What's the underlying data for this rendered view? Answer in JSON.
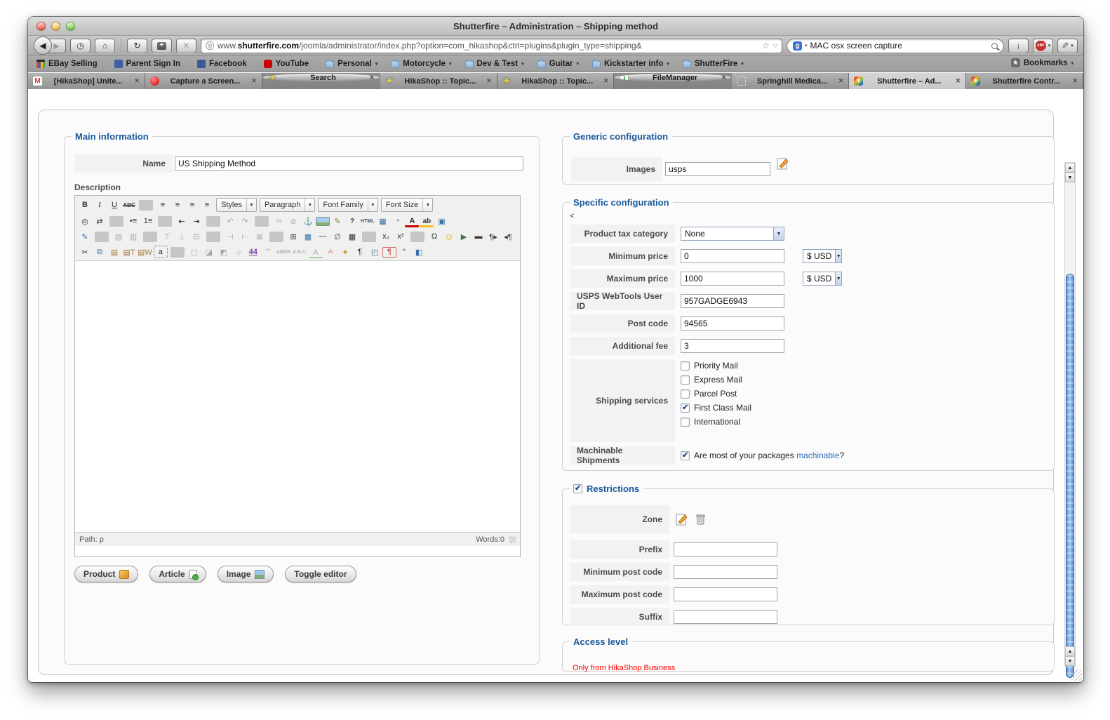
{
  "window": {
    "title": "Shutterfire – Administration – Shipping method"
  },
  "browser": {
    "nav": {
      "back": "◀",
      "forward": "▶",
      "history": "◷",
      "home": "⌂",
      "refresh": "↻",
      "save_plus": "+",
      "stop": "✕",
      "download": "↓",
      "star": "☆",
      "star_caret": "▽",
      "abp_label": "ABP",
      "quill": "✎"
    },
    "url": {
      "prefix": "www.",
      "domain": "shutterfire.com",
      "path": "/joomla/administrator/index.php?option=com_hikashop&ctrl=plugins&plugin_type=shipping&"
    },
    "search": {
      "engine_glyph": "g",
      "value": "MAC osx screen capture"
    },
    "bookmarks": [
      {
        "label": "EBay Selling",
        "icon": "ebay",
        "dropdown": false
      },
      {
        "label": "Parent Sign In",
        "icon": "p-badge",
        "dropdown": false
      },
      {
        "label": "Facebook",
        "icon": "facebook",
        "dropdown": false
      },
      {
        "label": "YouTube",
        "icon": "youtube",
        "dropdown": false
      },
      {
        "label": "Personal",
        "icon": "folder",
        "dropdown": true
      },
      {
        "label": "Motorcycle",
        "icon": "folder",
        "dropdown": true
      },
      {
        "label": "Dev & Test",
        "icon": "folder",
        "dropdown": true
      },
      {
        "label": "Guitar",
        "icon": "folder",
        "dropdown": true
      },
      {
        "label": "Kickstarter info",
        "icon": "folder",
        "dropdown": true
      },
      {
        "label": "ShutterFire",
        "icon": "folder",
        "dropdown": true
      }
    ],
    "bookmarks_menu_label": "Bookmarks",
    "tabs": [
      {
        "label": "[HikaShop] Unite...",
        "icon": "gmail",
        "active": false,
        "light": false
      },
      {
        "label": "Capture a Screen...",
        "icon": "balloon",
        "active": false,
        "light": false
      },
      {
        "label": "Search",
        "icon": "asterisk",
        "active": false,
        "light": true
      },
      {
        "label": "HikaShop :: Topic...",
        "icon": "asterisk",
        "active": false,
        "light": false
      },
      {
        "label": "HikaShop :: Topic...",
        "icon": "asterisk",
        "active": false,
        "light": false
      },
      {
        "label": "FileManager",
        "icon": "filemanager",
        "active": false,
        "light": true
      },
      {
        "label": "Springhill Medica...",
        "icon": "dashed",
        "active": false,
        "light": false
      },
      {
        "label": "Shutterfire – Ad...",
        "icon": "joomla",
        "active": true,
        "light": false
      },
      {
        "label": "Shutterfire Contr...",
        "icon": "joomla",
        "active": false,
        "light": false
      }
    ],
    "tab_close": "✕"
  },
  "page": {
    "main_information": {
      "legend": "Main information",
      "name_label": "Name",
      "name_value": "US Shipping Method",
      "description_label": "Description",
      "editor": {
        "row1_icons": [
          {
            "n": "bold-icon",
            "g": "B",
            "cls": "b"
          },
          {
            "n": "italic-icon",
            "g": "I",
            "cls": "i"
          },
          {
            "n": "underline-icon",
            "g": "U",
            "cls": "u"
          },
          {
            "n": "strikethrough-icon",
            "g": "ABC",
            "cls": "abc"
          },
          {
            "sep": true
          },
          {
            "n": "align-left-icon",
            "g": "≡"
          },
          {
            "n": "align-center-icon",
            "g": "≡"
          },
          {
            "n": "align-right-icon",
            "g": "≡"
          },
          {
            "n": "align-justify-icon",
            "g": "≡"
          }
        ],
        "selects": [
          {
            "n": "styles-select",
            "label": "Styles",
            "w": "sel-styles"
          },
          {
            "n": "paragraph-select",
            "label": "Paragraph",
            "w": "sel-para"
          },
          {
            "n": "font-family-select",
            "label": "Font Family",
            "w": "sel-font"
          },
          {
            "n": "font-size-select",
            "label": "Font Size",
            "w": "sel-size"
          }
        ],
        "row2_icons": [
          {
            "n": "find-icon",
            "g": "◎"
          },
          {
            "n": "find-replace-icon",
            "g": "⇄"
          },
          {
            "sep": true
          },
          {
            "n": "bullet-list-icon",
            "g": "•≡"
          },
          {
            "n": "numbered-list-icon",
            "g": "1≡"
          },
          {
            "sep": true
          },
          {
            "n": "outdent-icon",
            "g": "⇤"
          },
          {
            "n": "indent-icon",
            "g": "⇥"
          },
          {
            "sep": true
          },
          {
            "n": "undo-icon",
            "g": "↶",
            "dim": true
          },
          {
            "n": "redo-icon",
            "g": "↷",
            "dim": true
          },
          {
            "sep": true
          },
          {
            "n": "link-icon",
            "g": "∞",
            "dim": true
          },
          {
            "n": "unlink-icon",
            "g": "⊘",
            "dim": true
          },
          {
            "n": "anchor-icon",
            "g": "⚓",
            "cls": "c-navy"
          },
          {
            "n": "insert-image-icon",
            "g": "",
            "cls": "pic"
          },
          {
            "n": "cleanup-icon",
            "g": "✎",
            "cls": "c-olive"
          },
          {
            "n": "help-icon",
            "g": "?",
            "cls": "circ"
          },
          {
            "n": "html-source-icon",
            "g": "HTML",
            "cls": "txt"
          },
          {
            "n": "insert-date-icon",
            "g": "▦",
            "cls": "c-blue"
          },
          {
            "n": "insert-time-icon",
            "g": "◔",
            "cls": "c-blue"
          },
          {
            "n": "forecolor-icon",
            "g": "A",
            "cls": "fore"
          },
          {
            "n": "backcolor-icon",
            "g": "ab",
            "cls": "back"
          },
          {
            "n": "fullscreen-icon",
            "g": "▣",
            "cls": "c-blue"
          }
        ],
        "row3_icons": [
          {
            "n": "table-edit-icon",
            "g": "✎",
            "cls": "c-blue"
          },
          {
            "sep": true
          },
          {
            "n": "table-row-props-icon",
            "g": "▤",
            "dim": true
          },
          {
            "n": "table-cell-props-icon",
            "g": "▥",
            "dim": true
          },
          {
            "sep": true
          },
          {
            "n": "insert-row-before-icon",
            "g": "⊤",
            "dim": true
          },
          {
            "n": "insert-row-after-icon",
            "g": "⊥",
            "dim": true
          },
          {
            "n": "delete-row-icon",
            "g": "⊟",
            "dim": true
          },
          {
            "sep": true
          },
          {
            "n": "insert-col-before-icon",
            "g": "⊣",
            "dim": true
          },
          {
            "n": "insert-col-after-icon",
            "g": "⊢",
            "dim": true
          },
          {
            "n": "delete-col-icon",
            "g": "⊠",
            "dim": true
          },
          {
            "sep": true
          },
          {
            "n": "insert-table-icon",
            "g": "⊞"
          },
          {
            "n": "table-props-icon",
            "g": "▦",
            "cls": "c-blue"
          },
          {
            "n": "horizontal-rule-icon",
            "g": "—"
          },
          {
            "n": "remove-format-icon",
            "g": "∅"
          },
          {
            "n": "visual-aid-icon",
            "g": "▦"
          },
          {
            "sep": true
          },
          {
            "n": "subscript-icon",
            "g": "x₂"
          },
          {
            "n": "superscript-icon",
            "g": "x²"
          },
          {
            "sep": true
          },
          {
            "n": "special-char-icon",
            "g": "Ω"
          },
          {
            "n": "emoticon-icon",
            "g": "☺",
            "cls": "smiley"
          },
          {
            "n": "media-icon",
            "g": "▶",
            "cls": "media"
          },
          {
            "n": "advanced-hr-icon",
            "g": "▬"
          },
          {
            "n": "ltr-icon",
            "g": "¶▸"
          },
          {
            "n": "rtl-icon",
            "g": "◂¶"
          }
        ],
        "row4_icons": [
          {
            "n": "cut-icon",
            "g": "✂"
          },
          {
            "n": "copy-icon",
            "g": "⧉",
            "cls": "c-blue"
          },
          {
            "n": "paste-icon",
            "g": "▤",
            "cls": "c-brown"
          },
          {
            "n": "paste-text-icon",
            "g": "▤T",
            "cls": "c-brown"
          },
          {
            "n": "paste-word-icon",
            "g": "▤W",
            "cls": "c-brown"
          },
          {
            "n": "select-all-icon",
            "g": "a",
            "cls": "dashed"
          },
          {
            "sep": true
          },
          {
            "n": "toggle-absolute-icon",
            "g": "▢",
            "dim": true
          },
          {
            "n": "layer-forward-icon",
            "g": "◪",
            "dim": true
          },
          {
            "n": "layer-backward-icon",
            "g": "◩",
            "dim": true
          },
          {
            "n": "insert-layer-icon",
            "g": "⊹",
            "dim": true
          },
          {
            "n": "style-props-icon",
            "g": "44",
            "cls": "c-purple"
          },
          {
            "n": "cite-icon",
            "g": "“”",
            "dim": true
          },
          {
            "n": "abbr-icon",
            "g": "ABBR",
            "cls": "txt",
            "dim": true
          },
          {
            "n": "acronym-icon",
            "g": "A.B.C.",
            "cls": "txt",
            "dim": true
          },
          {
            "n": "ins-icon",
            "g": "A",
            "cls": "ins",
            "dim": true
          },
          {
            "n": "del-icon",
            "g": "A",
            "cls": "del",
            "dim": true
          },
          {
            "n": "attributes-icon",
            "g": "✦",
            "cls": "c-orange"
          },
          {
            "n": "paragraph-mark-icon",
            "g": "¶"
          },
          {
            "n": "preview-icon",
            "g": "◰",
            "cls": "c-blue"
          },
          {
            "n": "nowrap-icon",
            "g": "¶",
            "cls": "nowrap"
          },
          {
            "n": "blockquote-icon",
            "g": "“"
          },
          {
            "n": "template-icon",
            "g": "◧",
            "cls": "c-blue"
          }
        ],
        "path_label": "Path: p",
        "words_label": "Words:0"
      },
      "buttons": [
        {
          "label": "Product",
          "icon": "product"
        },
        {
          "label": "Article",
          "icon": "article"
        },
        {
          "label": "Image",
          "icon": "image"
        },
        {
          "label": "Toggle editor",
          "icon": "none"
        }
      ]
    },
    "generic_configuration": {
      "legend": "Generic configuration",
      "images_label": "Images",
      "images_value": "usps"
    },
    "specific_configuration": {
      "legend": "Specific configuration",
      "stray": "<",
      "tax_label": "Product tax category",
      "tax_value": "None",
      "min_price_label": "Minimum price",
      "min_price_value": "0",
      "min_price_currency": "$ USD",
      "max_price_label": "Maximum price",
      "max_price_value": "1000",
      "max_price_currency": "$ USD",
      "usps_id_label": "USPS WebTools User ID",
      "usps_id_value": "957GADGE6943",
      "post_code_label": "Post code",
      "post_code_value": "94565",
      "additional_fee_label": "Additional fee",
      "additional_fee_value": "3",
      "services_label": "Shipping services",
      "services": [
        {
          "label": "Priority Mail",
          "checked": false
        },
        {
          "label": "Express Mail",
          "checked": false
        },
        {
          "label": "Parcel Post",
          "checked": false
        },
        {
          "label": "First Class Mail",
          "checked": true
        },
        {
          "label": "International",
          "checked": false
        }
      ],
      "machinable_label": "Machinable Shipments",
      "machinable_checked": true,
      "machinable_text": "Are most of your packages ",
      "machinable_link": "machinable",
      "machinable_suffix": "?"
    },
    "restrictions": {
      "legend": "Restrictions",
      "legend_checked": true,
      "zone_label": "Zone",
      "rows": [
        {
          "label": "Prefix",
          "value": ""
        },
        {
          "label": "Minimum post code",
          "value": ""
        },
        {
          "label": "Maximum post code",
          "value": ""
        },
        {
          "label": "Suffix",
          "value": ""
        }
      ]
    },
    "access_level": {
      "legend": "Access level",
      "warning": "Only from HikaShop Business"
    }
  }
}
